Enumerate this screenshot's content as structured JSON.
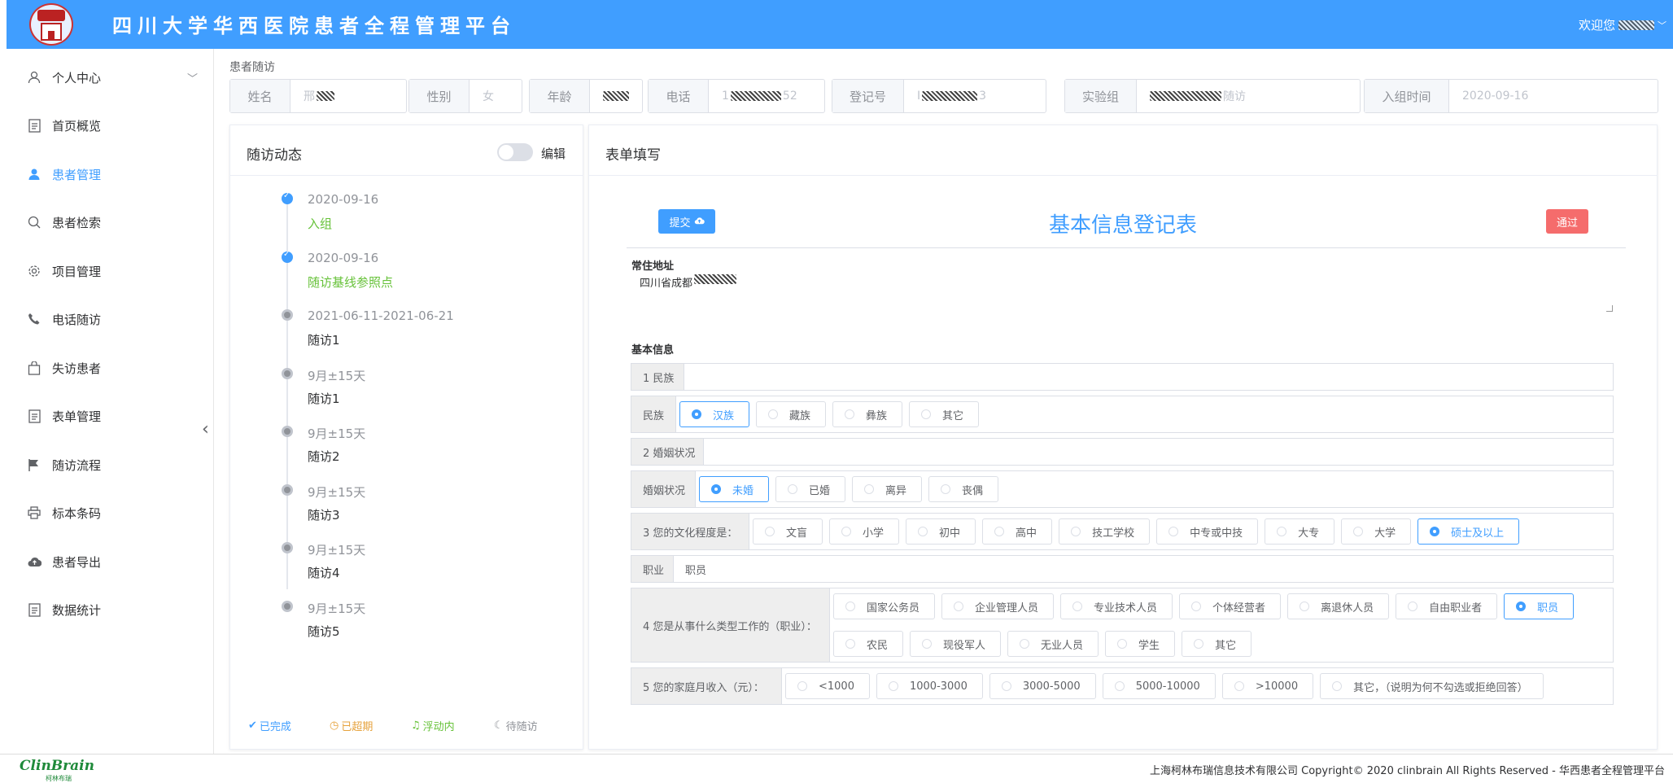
{
  "header": {
    "title": "四川大学华西医院患者全程管理平台",
    "welcome": "欢迎您",
    "colors": {
      "bar": "#409eff"
    }
  },
  "sidebar": {
    "items": [
      {
        "label": "个人中心",
        "icon": "user-icon"
      },
      {
        "label": "首页概览",
        "icon": "document-icon"
      },
      {
        "label": "患者管理",
        "icon": "user-filled-icon",
        "active": true
      },
      {
        "label": "患者检索",
        "icon": "search-icon"
      },
      {
        "label": "项目管理",
        "icon": "gear-icon"
      },
      {
        "label": "电话随访",
        "icon": "phone-icon"
      },
      {
        "label": "失访患者",
        "icon": "bag-icon"
      },
      {
        "label": "表单管理",
        "icon": "document-icon"
      },
      {
        "label": "随访流程",
        "icon": "flag-icon"
      },
      {
        "label": "标本条码",
        "icon": "printer-icon"
      },
      {
        "label": "患者导出",
        "icon": "cloud-upload-icon"
      },
      {
        "label": "数据统计",
        "icon": "document-icon"
      }
    ]
  },
  "breadcrumb": "患者随访",
  "patient": {
    "name_label": "姓名",
    "name": "邢",
    "gender_label": "性别",
    "gender": "女",
    "age_label": "年龄",
    "phone_label": "电话",
    "phone_prefix": "1",
    "phone_suffix": "52",
    "reg_label": "登记号",
    "reg_prefix": "I",
    "reg_suffix": "3",
    "group_label": "实验组",
    "group_suffix": "随访",
    "join_label": "入组时间",
    "join_date": "2020-09-16"
  },
  "timeline_panel": {
    "title": "随访动态",
    "edit_label": "编辑",
    "items": [
      {
        "date": "2020-09-16",
        "label": "入组",
        "status": "done"
      },
      {
        "date": "2020-09-16",
        "label": "随访基线参照点",
        "status": "done"
      },
      {
        "date": "2021-06-11-2021-06-21",
        "label": "随访1",
        "status": "wait"
      },
      {
        "date": "9月±15天",
        "label": "随访1",
        "status": "wait"
      },
      {
        "date": "9月±15天",
        "label": "随访2",
        "status": "wait"
      },
      {
        "date": "9月±15天",
        "label": "随访3",
        "status": "wait"
      },
      {
        "date": "9月±15天",
        "label": "随访4",
        "status": "wait"
      },
      {
        "date": "9月±15天",
        "label": "随访5",
        "status": "wait"
      }
    ],
    "legend": [
      {
        "label": "已完成",
        "icon": "check-circle-icon",
        "color": "#409eff"
      },
      {
        "label": "已超期",
        "icon": "clock-icon",
        "color": "#e6a23c"
      },
      {
        "label": "浮动内",
        "icon": "bell-icon",
        "color": "#67c23a"
      },
      {
        "label": "待随访",
        "icon": "moon-icon",
        "color": "#909399"
      }
    ]
  },
  "form_panel": {
    "title": "表单填写",
    "submit_label": "提交",
    "pass_label": "通过",
    "form_title": "基本信息登记表",
    "address_label": "常住地址",
    "address_value": "四川省成都",
    "section_label": "基本信息",
    "q1_label": "1 民族",
    "ethnic_label": "民族",
    "ethnic_options": [
      "汉族",
      "藏族",
      "彝族",
      "其它"
    ],
    "ethnic_selected": 0,
    "q2_label": "2 婚姻状况",
    "marital_label": "婚姻状况",
    "marital_options": [
      "未婚",
      "已婚",
      "离异",
      "丧偶"
    ],
    "marital_selected": 0,
    "q3_label": "3 您的文化程度是：",
    "edu_options": [
      "文盲",
      "小学",
      "初中",
      "高中",
      "技工学校",
      "中专或中技",
      "大专",
      "大学",
      "硕士及以上"
    ],
    "edu_selected": 8,
    "job_label": "职业",
    "job_value": "职员",
    "q4_label": "4 您是从事什么类型工作的（职业）：",
    "work_options": [
      "国家公务员",
      "企业管理人员",
      "专业技术人员",
      "个体经营者",
      "离退休人员",
      "自由职业者",
      "职员",
      "农民",
      "现役军人",
      "无业人员",
      "学生",
      "其它"
    ],
    "work_selected": 6,
    "q5_label": "5 您的家庭月收入（元）：",
    "income_options": [
      "<1000",
      "1000-3000",
      "3000-5000",
      "5000-10000",
      ">10000",
      "其它，（说明为何不勾选或拒绝回答）"
    ],
    "income_selected": -1
  },
  "footer": {
    "brand": "ClinBrain",
    "brand_sub": "柯林布瑞",
    "copyright": "上海柯林布瑞信息技术有限公司 Copyright© 2020 clinbrain All Rights Reserved - 华西患者全程管理平台"
  }
}
